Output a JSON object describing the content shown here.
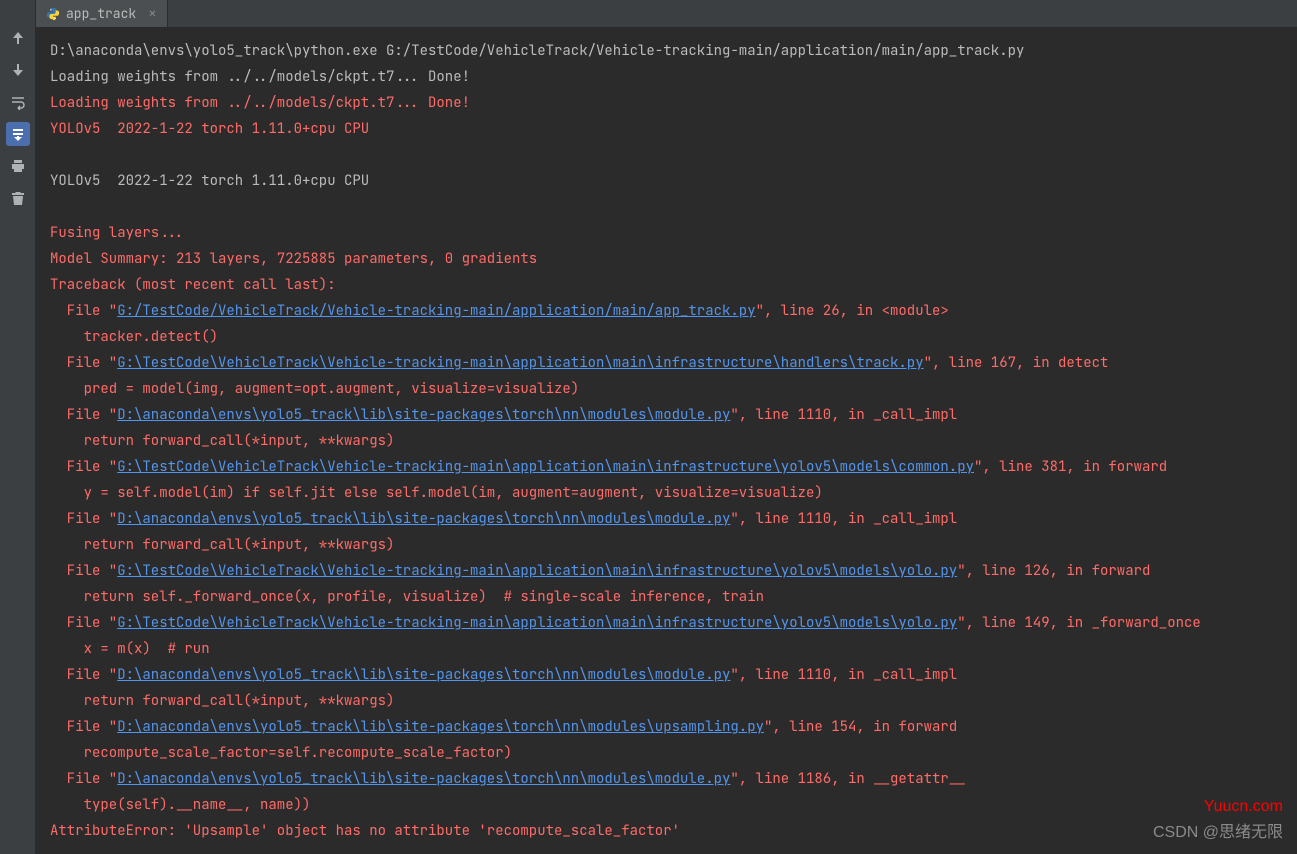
{
  "tab": {
    "label": "app_track",
    "icon": "python-icon"
  },
  "gutter_icons": [
    {
      "name": "arrow-up-icon"
    },
    {
      "name": "arrow-down-icon"
    },
    {
      "name": "soft-wrap-icon"
    },
    {
      "name": "scroll-to-end-icon",
      "active": true
    },
    {
      "name": "print-icon"
    },
    {
      "name": "trash-icon"
    }
  ],
  "console": {
    "lines": [
      {
        "type": "plain",
        "segs": [
          {
            "t": "D:\\anaconda\\envs\\yolo5_track\\python.exe G:/TestCode/VehicleTrack/Vehicle-tracking-main/application/main/app_track.py"
          }
        ]
      },
      {
        "type": "plain",
        "segs": [
          {
            "t": "Loading weights from ../../models/ckpt.t7... Done!"
          }
        ]
      },
      {
        "type": "red",
        "segs": [
          {
            "t": "Loading weights from ../../models/ckpt.t7... Done!"
          }
        ]
      },
      {
        "type": "red",
        "segs": [
          {
            "t": "YOLOv5  2022-1-22 torch 1.11.0+cpu CPU"
          }
        ]
      },
      {
        "type": "red",
        "segs": [
          {
            "t": ""
          }
        ]
      },
      {
        "type": "plain",
        "segs": [
          {
            "t": "YOLOv5  2022-1-22 torch 1.11.0+cpu CPU"
          }
        ]
      },
      {
        "type": "plain",
        "segs": [
          {
            "t": ""
          }
        ]
      },
      {
        "type": "red",
        "segs": [
          {
            "t": "Fusing layers... "
          }
        ]
      },
      {
        "type": "red",
        "segs": [
          {
            "t": "Model Summary: 213 layers, 7225885 parameters, 0 gradients"
          }
        ]
      },
      {
        "type": "red",
        "segs": [
          {
            "t": "Traceback (most recent call last):"
          }
        ]
      },
      {
        "type": "red",
        "segs": [
          {
            "t": "  File \""
          },
          {
            "t": "G:/TestCode/VehicleTrack/Vehicle-tracking-main/application/main/app_track.py",
            "link": true
          },
          {
            "t": "\", line 26, in <module>"
          }
        ]
      },
      {
        "type": "red",
        "segs": [
          {
            "t": "    tracker.detect()"
          }
        ]
      },
      {
        "type": "red",
        "segs": [
          {
            "t": "  File \""
          },
          {
            "t": "G:\\TestCode\\VehicleTrack\\Vehicle-tracking-main\\application\\main\\infrastructure\\handlers\\track.py",
            "link": true
          },
          {
            "t": "\", line 167, in detect"
          }
        ]
      },
      {
        "type": "red",
        "segs": [
          {
            "t": "    pred = model(img, augment=opt.augment, visualize=visualize)"
          }
        ]
      },
      {
        "type": "red",
        "segs": [
          {
            "t": "  File \""
          },
          {
            "t": "D:\\anaconda\\envs\\yolo5_track\\lib\\site-packages\\torch\\nn\\modules\\module.py",
            "link": true
          },
          {
            "t": "\", line 1110, in _call_impl"
          }
        ]
      },
      {
        "type": "red",
        "segs": [
          {
            "t": "    return forward_call(*input, **kwargs)"
          }
        ]
      },
      {
        "type": "red",
        "segs": [
          {
            "t": "  File \""
          },
          {
            "t": "G:\\TestCode\\VehicleTrack\\Vehicle-tracking-main\\application\\main\\infrastructure\\yolov5\\models\\common.py",
            "link": true
          },
          {
            "t": "\", line 381, in forward"
          }
        ]
      },
      {
        "type": "red",
        "segs": [
          {
            "t": "    y = self.model(im) if self.jit else self.model(im, augment=augment, visualize=visualize)"
          }
        ]
      },
      {
        "type": "red",
        "segs": [
          {
            "t": "  File \""
          },
          {
            "t": "D:\\anaconda\\envs\\yolo5_track\\lib\\site-packages\\torch\\nn\\modules\\module.py",
            "link": true
          },
          {
            "t": "\", line 1110, in _call_impl"
          }
        ]
      },
      {
        "type": "red",
        "segs": [
          {
            "t": "    return forward_call(*input, **kwargs)"
          }
        ]
      },
      {
        "type": "red",
        "segs": [
          {
            "t": "  File \""
          },
          {
            "t": "G:\\TestCode\\VehicleTrack\\Vehicle-tracking-main\\application\\main\\infrastructure\\yolov5\\models\\yolo.py",
            "link": true
          },
          {
            "t": "\", line 126, in forward"
          }
        ]
      },
      {
        "type": "red",
        "segs": [
          {
            "t": "    return self._forward_once(x, profile, visualize)  # single-scale inference, train"
          }
        ]
      },
      {
        "type": "red",
        "segs": [
          {
            "t": "  File \""
          },
          {
            "t": "G:\\TestCode\\VehicleTrack\\Vehicle-tracking-main\\application\\main\\infrastructure\\yolov5\\models\\yolo.py",
            "link": true
          },
          {
            "t": "\", line 149, in _forward_once"
          }
        ]
      },
      {
        "type": "red",
        "segs": [
          {
            "t": "    x = m(x)  # run"
          }
        ]
      },
      {
        "type": "red",
        "segs": [
          {
            "t": "  File \""
          },
          {
            "t": "D:\\anaconda\\envs\\yolo5_track\\lib\\site-packages\\torch\\nn\\modules\\module.py",
            "link": true
          },
          {
            "t": "\", line 1110, in _call_impl"
          }
        ]
      },
      {
        "type": "red",
        "segs": [
          {
            "t": "    return forward_call(*input, **kwargs)"
          }
        ]
      },
      {
        "type": "red",
        "segs": [
          {
            "t": "  File \""
          },
          {
            "t": "D:\\anaconda\\envs\\yolo5_track\\lib\\site-packages\\torch\\nn\\modules\\upsampling.py",
            "link": true
          },
          {
            "t": "\", line 154, in forward"
          }
        ]
      },
      {
        "type": "red",
        "segs": [
          {
            "t": "    recompute_scale_factor=self.recompute_scale_factor)"
          }
        ]
      },
      {
        "type": "red",
        "segs": [
          {
            "t": "  File \""
          },
          {
            "t": "D:\\anaconda\\envs\\yolo5_track\\lib\\site-packages\\torch\\nn\\modules\\module.py",
            "link": true
          },
          {
            "t": "\", line 1186, in __getattr__"
          }
        ]
      },
      {
        "type": "red",
        "segs": [
          {
            "t": "    type(self).__name__, name))"
          }
        ]
      },
      {
        "type": "red",
        "segs": [
          {
            "t": "AttributeError: 'Upsample' object has no attribute 'recompute_scale_factor'"
          }
        ]
      }
    ]
  },
  "watermark": {
    "top": "Yuucn.com",
    "bottom": "CSDN @思绪无限"
  }
}
